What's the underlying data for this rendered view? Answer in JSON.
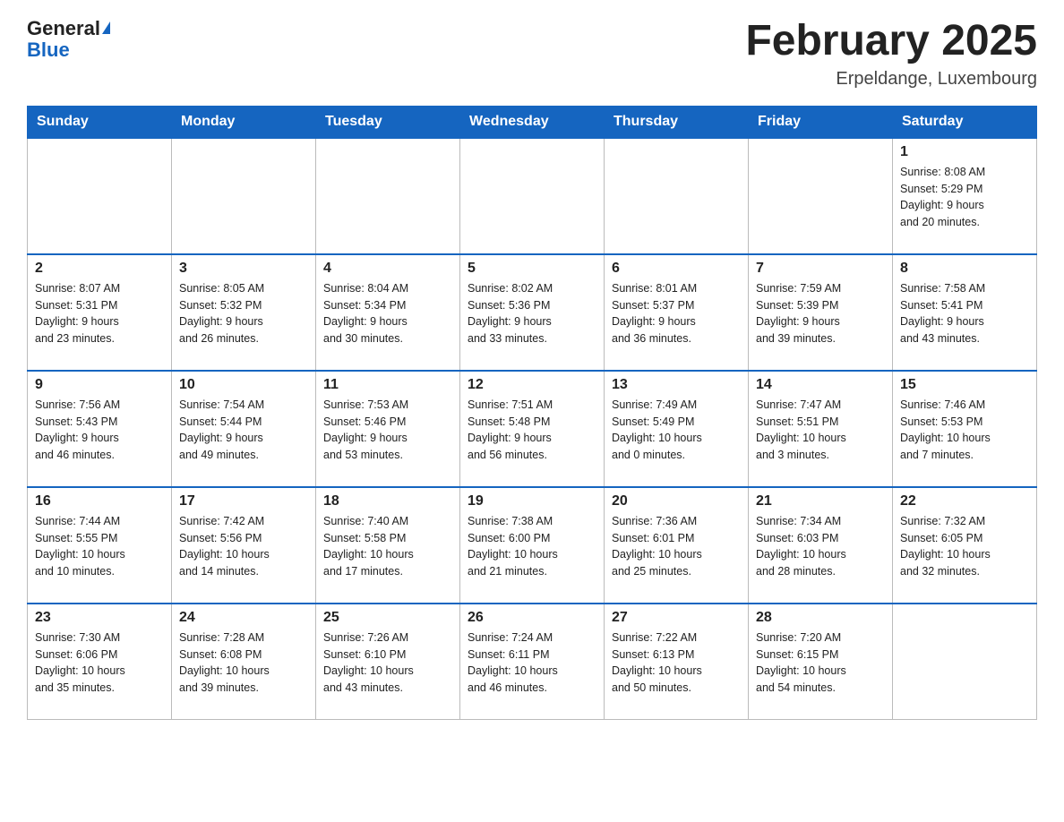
{
  "header": {
    "logo_general": "General",
    "logo_blue": "Blue",
    "title": "February 2025",
    "location": "Erpeldange, Luxembourg"
  },
  "days_of_week": [
    "Sunday",
    "Monday",
    "Tuesday",
    "Wednesday",
    "Thursday",
    "Friday",
    "Saturday"
  ],
  "weeks": [
    [
      {
        "day": "",
        "info": ""
      },
      {
        "day": "",
        "info": ""
      },
      {
        "day": "",
        "info": ""
      },
      {
        "day": "",
        "info": ""
      },
      {
        "day": "",
        "info": ""
      },
      {
        "day": "",
        "info": ""
      },
      {
        "day": "1",
        "info": "Sunrise: 8:08 AM\nSunset: 5:29 PM\nDaylight: 9 hours\nand 20 minutes."
      }
    ],
    [
      {
        "day": "2",
        "info": "Sunrise: 8:07 AM\nSunset: 5:31 PM\nDaylight: 9 hours\nand 23 minutes."
      },
      {
        "day": "3",
        "info": "Sunrise: 8:05 AM\nSunset: 5:32 PM\nDaylight: 9 hours\nand 26 minutes."
      },
      {
        "day": "4",
        "info": "Sunrise: 8:04 AM\nSunset: 5:34 PM\nDaylight: 9 hours\nand 30 minutes."
      },
      {
        "day": "5",
        "info": "Sunrise: 8:02 AM\nSunset: 5:36 PM\nDaylight: 9 hours\nand 33 minutes."
      },
      {
        "day": "6",
        "info": "Sunrise: 8:01 AM\nSunset: 5:37 PM\nDaylight: 9 hours\nand 36 minutes."
      },
      {
        "day": "7",
        "info": "Sunrise: 7:59 AM\nSunset: 5:39 PM\nDaylight: 9 hours\nand 39 minutes."
      },
      {
        "day": "8",
        "info": "Sunrise: 7:58 AM\nSunset: 5:41 PM\nDaylight: 9 hours\nand 43 minutes."
      }
    ],
    [
      {
        "day": "9",
        "info": "Sunrise: 7:56 AM\nSunset: 5:43 PM\nDaylight: 9 hours\nand 46 minutes."
      },
      {
        "day": "10",
        "info": "Sunrise: 7:54 AM\nSunset: 5:44 PM\nDaylight: 9 hours\nand 49 minutes."
      },
      {
        "day": "11",
        "info": "Sunrise: 7:53 AM\nSunset: 5:46 PM\nDaylight: 9 hours\nand 53 minutes."
      },
      {
        "day": "12",
        "info": "Sunrise: 7:51 AM\nSunset: 5:48 PM\nDaylight: 9 hours\nand 56 minutes."
      },
      {
        "day": "13",
        "info": "Sunrise: 7:49 AM\nSunset: 5:49 PM\nDaylight: 10 hours\nand 0 minutes."
      },
      {
        "day": "14",
        "info": "Sunrise: 7:47 AM\nSunset: 5:51 PM\nDaylight: 10 hours\nand 3 minutes."
      },
      {
        "day": "15",
        "info": "Sunrise: 7:46 AM\nSunset: 5:53 PM\nDaylight: 10 hours\nand 7 minutes."
      }
    ],
    [
      {
        "day": "16",
        "info": "Sunrise: 7:44 AM\nSunset: 5:55 PM\nDaylight: 10 hours\nand 10 minutes."
      },
      {
        "day": "17",
        "info": "Sunrise: 7:42 AM\nSunset: 5:56 PM\nDaylight: 10 hours\nand 14 minutes."
      },
      {
        "day": "18",
        "info": "Sunrise: 7:40 AM\nSunset: 5:58 PM\nDaylight: 10 hours\nand 17 minutes."
      },
      {
        "day": "19",
        "info": "Sunrise: 7:38 AM\nSunset: 6:00 PM\nDaylight: 10 hours\nand 21 minutes."
      },
      {
        "day": "20",
        "info": "Sunrise: 7:36 AM\nSunset: 6:01 PM\nDaylight: 10 hours\nand 25 minutes."
      },
      {
        "day": "21",
        "info": "Sunrise: 7:34 AM\nSunset: 6:03 PM\nDaylight: 10 hours\nand 28 minutes."
      },
      {
        "day": "22",
        "info": "Sunrise: 7:32 AM\nSunset: 6:05 PM\nDaylight: 10 hours\nand 32 minutes."
      }
    ],
    [
      {
        "day": "23",
        "info": "Sunrise: 7:30 AM\nSunset: 6:06 PM\nDaylight: 10 hours\nand 35 minutes."
      },
      {
        "day": "24",
        "info": "Sunrise: 7:28 AM\nSunset: 6:08 PM\nDaylight: 10 hours\nand 39 minutes."
      },
      {
        "day": "25",
        "info": "Sunrise: 7:26 AM\nSunset: 6:10 PM\nDaylight: 10 hours\nand 43 minutes."
      },
      {
        "day": "26",
        "info": "Sunrise: 7:24 AM\nSunset: 6:11 PM\nDaylight: 10 hours\nand 46 minutes."
      },
      {
        "day": "27",
        "info": "Sunrise: 7:22 AM\nSunset: 6:13 PM\nDaylight: 10 hours\nand 50 minutes."
      },
      {
        "day": "28",
        "info": "Sunrise: 7:20 AM\nSunset: 6:15 PM\nDaylight: 10 hours\nand 54 minutes."
      },
      {
        "day": "",
        "info": ""
      }
    ]
  ]
}
